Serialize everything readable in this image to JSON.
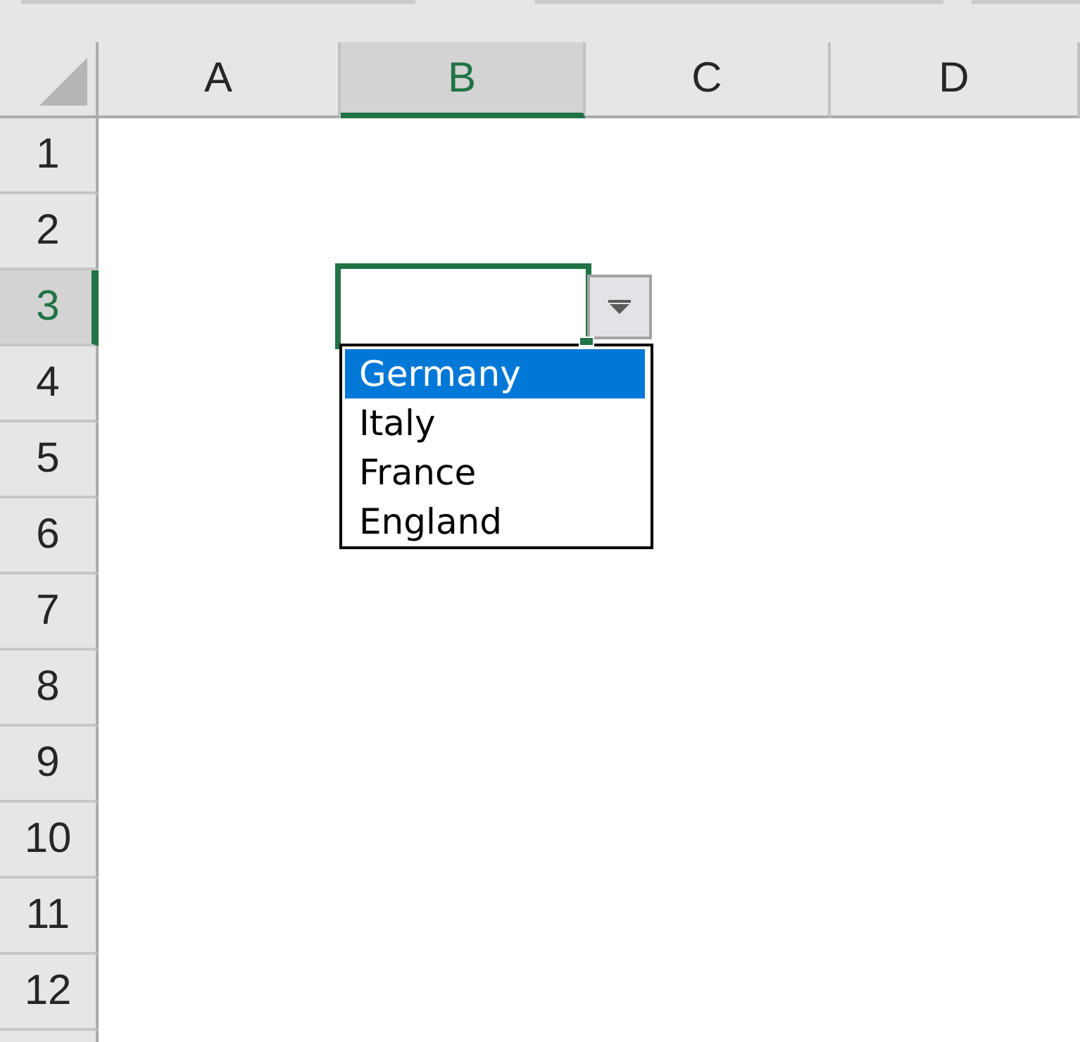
{
  "columns": [
    {
      "label": "A",
      "selected": false
    },
    {
      "label": "B",
      "selected": true
    },
    {
      "label": "C",
      "selected": false
    },
    {
      "label": "D",
      "selected": false
    }
  ],
  "rows": [
    {
      "label": "1",
      "selected": false
    },
    {
      "label": "2",
      "selected": false
    },
    {
      "label": "3",
      "selected": true
    },
    {
      "label": "4",
      "selected": false
    },
    {
      "label": "5",
      "selected": false
    },
    {
      "label": "6",
      "selected": false
    },
    {
      "label": "7",
      "selected": false
    },
    {
      "label": "8",
      "selected": false
    },
    {
      "label": "9",
      "selected": false
    },
    {
      "label": "10",
      "selected": false
    },
    {
      "label": "11",
      "selected": false
    },
    {
      "label": "12",
      "selected": false
    }
  ],
  "dropdown": {
    "items": [
      {
        "label": "Germany",
        "selected": true
      },
      {
        "label": "Italy",
        "selected": false
      },
      {
        "label": "France",
        "selected": false
      },
      {
        "label": "England",
        "selected": false
      }
    ]
  }
}
